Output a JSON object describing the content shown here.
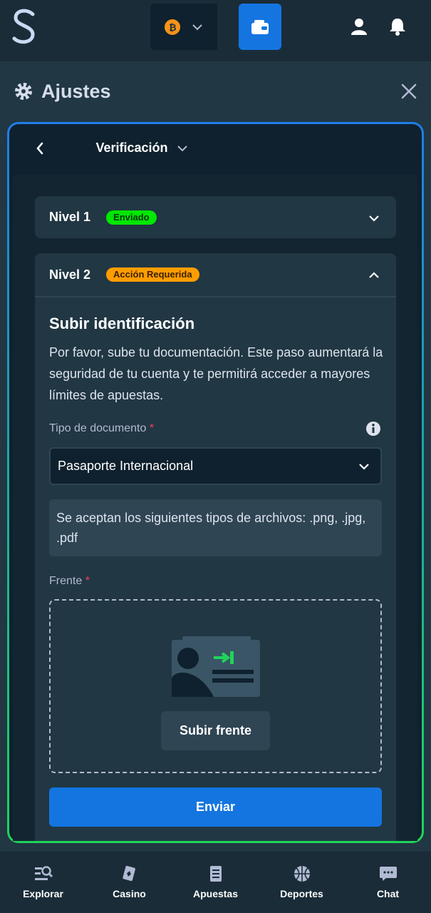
{
  "header": {
    "logo_icon": "s-logo-icon",
    "currency_icon": "bitcoin-icon",
    "wallet_icon": "wallet-icon",
    "user_icon": "user-icon",
    "notifications_icon": "bell-icon",
    "accent_color": "#1475e1"
  },
  "settings": {
    "title": "Ajustes",
    "section": "Verificación"
  },
  "levels": [
    {
      "label": "Nivel 1",
      "badge": "Enviado",
      "badge_color": "#00e701",
      "expanded": false
    },
    {
      "label": "Nivel 2",
      "badge": "Acción Requerida",
      "badge_color": "#ff9d00",
      "expanded": true
    }
  ],
  "upload": {
    "title": "Subir identificación",
    "description": "Por favor, sube tu documentación. Este paso aumentará la seguridad de tu cuenta y te permitirá acceder a mayores límites de apuestas.",
    "doc_type_label": "Tipo de documento",
    "doc_type_value": "Pasaporte Internacional",
    "file_types_note": "Se aceptan los siguientes tipos de archivos: .png, .jpg, .pdf",
    "front_label": "Frente",
    "required_mark": "*",
    "upload_front_button": "Subir frente",
    "submit_button": "Enviar"
  },
  "bottom_nav": [
    {
      "label": "Explorar",
      "icon": "browse-icon"
    },
    {
      "label": "Casino",
      "icon": "cards-icon"
    },
    {
      "label": "Apuestas",
      "icon": "betslip-icon"
    },
    {
      "label": "Deportes",
      "icon": "basketball-icon"
    },
    {
      "label": "Chat",
      "icon": "chat-icon"
    }
  ]
}
